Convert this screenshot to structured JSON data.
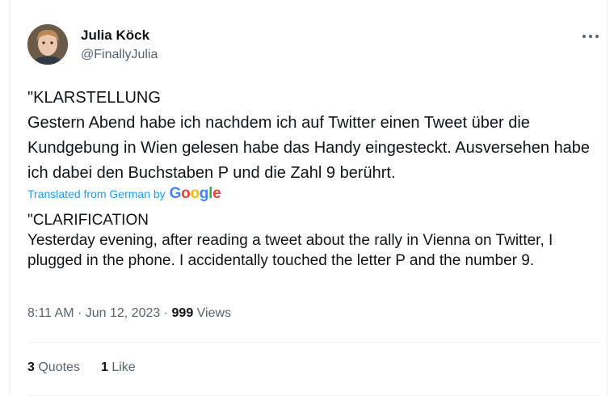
{
  "author": {
    "name": "Julia Köck",
    "handle": "@FinallyJulia"
  },
  "tweet": {
    "original_text": "\"KLARSTELLUNG\nGestern Abend habe ich nachdem ich auf Twitter einen Tweet über die Kundgebung in Wien gelesen habe das Handy eingesteckt. Ausversehen habe ich dabei den Buchstaben P und die Zahl 9 berührt.",
    "translated_label": "Translated from German by",
    "google_logo": "Google",
    "translation_text": "\"CLARIFICATION\nYesterday evening, after reading a tweet about the rally in Vienna on Twitter, I plugged in the phone. I accidentally touched the letter P and the number 9."
  },
  "meta": {
    "time": "8:11 AM",
    "separator": "·",
    "date": "Jun 12, 2023",
    "views_count": "999",
    "views_label": "Views"
  },
  "stats": {
    "quotes_count": "3",
    "quotes_label": "Quotes",
    "likes_count": "1",
    "likes_label": "Like"
  },
  "colors": {
    "link": "#1d9bf0",
    "secondary": "#536471",
    "text": "#0f1419"
  }
}
